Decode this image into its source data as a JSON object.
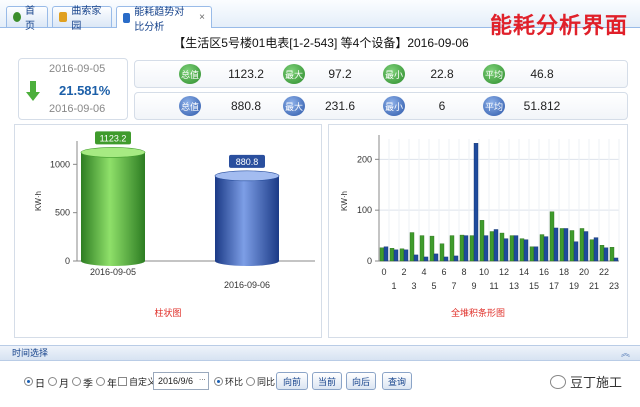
{
  "tabs": [
    {
      "label": "首页",
      "icon": "home-icon",
      "color": "#3b8e2c",
      "closable": false
    },
    {
      "label": "曲索家园",
      "icon": "document-icon",
      "color": "#e0a020",
      "closable": false
    },
    {
      "label": "能耗趋势对比分析",
      "icon": "chart-icon",
      "color": "#2a6cc8",
      "closable": true,
      "close": "×"
    }
  ],
  "overlay_title": "能耗分析界面",
  "header": "【生活区5号楼01电表[1-2-543] 等4个设备】2016-09-06",
  "comparison": {
    "date_prev": "2016-09-05",
    "date_curr": "2016-09-06",
    "percent": "21.581%",
    "arrow_color": "#4caf3c"
  },
  "stats": [
    {
      "items": [
        {
          "label": "总值",
          "value": "1123.2"
        },
        {
          "label": "最大",
          "value": "97.2"
        },
        {
          "label": "最小",
          "value": "22.8"
        },
        {
          "label": "平均",
          "value": "46.8"
        }
      ]
    },
    {
      "items": [
        {
          "label": "总值",
          "value": "880.8"
        },
        {
          "label": "最大",
          "value": "231.6"
        },
        {
          "label": "最小",
          "value": "6"
        },
        {
          "label": "平均",
          "value": "51.812"
        }
      ]
    }
  ],
  "colors": {
    "green": "#3f9b2c",
    "blue": "#1f4a9c",
    "accent_red": "#e0302a"
  },
  "chart_data": [
    {
      "type": "bar",
      "title": "柱状图",
      "ylabel": "KW·h",
      "ylim": [
        0,
        1200
      ],
      "yticks": [
        "0",
        "500",
        "1000"
      ],
      "categories": [
        "2016-09-05",
        "2016-09-06"
      ],
      "values": [
        1123.2,
        880.8
      ],
      "value_labels": [
        "1123.2",
        "880.8"
      ],
      "colors": [
        "#3f9b2c",
        "#2a4f9e"
      ]
    },
    {
      "type": "bar",
      "title": "全堆积条形图",
      "ylabel": "KW·h",
      "ylim": [
        0,
        240
      ],
      "yticks": [
        "0",
        "100",
        "200"
      ],
      "x_even": [
        "0",
        "2",
        "4",
        "6",
        "8",
        "10",
        "12",
        "14",
        "16",
        "18",
        "20",
        "22"
      ],
      "x_odd": [
        "1",
        "3",
        "5",
        "7",
        "9",
        "11",
        "13",
        "15",
        "17",
        "19",
        "21",
        "23"
      ],
      "categories": [
        "0",
        "1",
        "2",
        "3",
        "4",
        "5",
        "6",
        "7",
        "8",
        "9",
        "10",
        "11",
        "12",
        "13",
        "14",
        "15",
        "16",
        "17",
        "18",
        "19",
        "20",
        "21",
        "22",
        "23"
      ],
      "series": [
        {
          "values": [
            26,
            25,
            24,
            56,
            50,
            49,
            34,
            50,
            51,
            50,
            80,
            58,
            55,
            50,
            44,
            28,
            52,
            97,
            64,
            60,
            64,
            42,
            31,
            27
          ]
        },
        {
          "values": [
            28,
            22,
            22,
            12,
            8,
            14,
            8,
            10,
            50,
            231.6,
            50,
            62,
            44,
            50,
            42,
            28,
            48,
            65,
            64,
            38,
            58,
            46,
            26,
            6
          ]
        }
      ]
    }
  ],
  "timebar": {
    "title": "时间选择",
    "collapse": "︽"
  },
  "controls": {
    "period_options": [
      "日",
      "月",
      "季",
      "年"
    ],
    "custom_label": "自定义",
    "date_value": "2016/9/6",
    "date_picker": "...",
    "compare_options": [
      "环比",
      "同比"
    ],
    "buttons": [
      "向前",
      "当前",
      "向后",
      "查询"
    ]
  },
  "watermark": "豆丁施工"
}
